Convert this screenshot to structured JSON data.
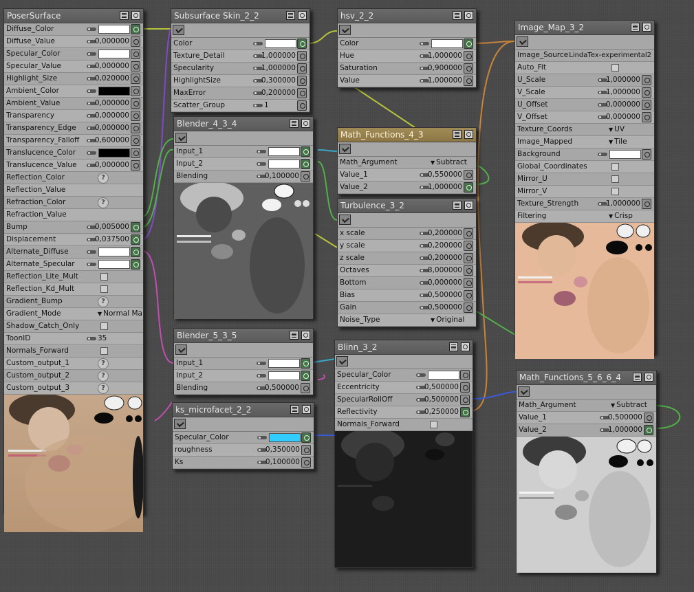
{
  "nodes": {
    "poser_surface": {
      "title": "PoserSurface",
      "rows": [
        {
          "label": "Diffuse_Color",
          "kind": "color",
          "color": "#ffffff",
          "plug": "connected"
        },
        {
          "label": "Diffuse_Value",
          "kind": "number",
          "value": "0,000000",
          "plug": "plain"
        },
        {
          "label": "Specular_Color",
          "kind": "color",
          "color": "#ffffff",
          "plug": "plain"
        },
        {
          "label": "Specular_Value",
          "kind": "number",
          "value": "0,000000",
          "plug": "plain"
        },
        {
          "label": "Highlight_Size",
          "kind": "number",
          "value": "0,020000",
          "plug": "plain"
        },
        {
          "label": "Ambient_Color",
          "kind": "color",
          "color": "#000000",
          "plug": "plain"
        },
        {
          "label": "Ambient_Value",
          "kind": "number",
          "value": "0,000000",
          "plug": "plain"
        },
        {
          "label": "Transparency",
          "kind": "number",
          "value": "0,000000",
          "plug": "plain"
        },
        {
          "label": "Transparency_Edge",
          "kind": "number",
          "value": "0,000000",
          "plug": "plain"
        },
        {
          "label": "Transparency_Falloff",
          "kind": "number",
          "value": "0,600000",
          "plug": "plain"
        },
        {
          "label": "Translucence_Color",
          "kind": "color",
          "color": "#000000",
          "plug": "plain"
        },
        {
          "label": "Translucence_Value",
          "kind": "number",
          "value": "0,000000",
          "plug": "plain"
        },
        {
          "label": "Reflection_Color",
          "kind": "help"
        },
        {
          "label": "Reflection_Value",
          "kind": "empty"
        },
        {
          "label": "Refraction_Color",
          "kind": "help"
        },
        {
          "label": "Refraction_Value",
          "kind": "empty"
        },
        {
          "label": "Bump",
          "kind": "number",
          "value": "0,005000",
          "plug": "connected"
        },
        {
          "label": "Displacement",
          "kind": "number",
          "value": "0,037500",
          "plug": "connected"
        },
        {
          "label": "Alternate_Diffuse",
          "kind": "color",
          "color": "#ffffff",
          "plug": "connected"
        },
        {
          "label": "Alternate_Specular",
          "kind": "color",
          "color": "#ffffff",
          "plug": "connected"
        },
        {
          "label": "Reflection_Lite_Mult",
          "kind": "check"
        },
        {
          "label": "Reflection_Kd_Mult",
          "kind": "check"
        },
        {
          "label": "Gradient_Bump",
          "kind": "help"
        },
        {
          "label": "Gradient_Mode",
          "kind": "dropdown",
          "value": "Normal Ma"
        },
        {
          "label": "Shadow_Catch_Only",
          "kind": "check"
        },
        {
          "label": "ToonID",
          "kind": "number",
          "value": "35",
          "align": "left"
        },
        {
          "label": "Normals_Forward",
          "kind": "check"
        },
        {
          "label": "Custom_output_1",
          "kind": "help"
        },
        {
          "label": "Custom_output_2",
          "kind": "help"
        },
        {
          "label": "Custom_output_3",
          "kind": "help"
        }
      ]
    },
    "subsurface_skin": {
      "title": "Subsurface Skin_2_2",
      "rows": [
        {
          "label": "Color",
          "kind": "color",
          "color": "#ffffff",
          "plug": "connected"
        },
        {
          "label": "Texture_Detail",
          "kind": "number",
          "value": "1,000000",
          "plug": "plain"
        },
        {
          "label": "Specularity",
          "kind": "number",
          "value": "1,000000",
          "plug": "plain"
        },
        {
          "label": "HighlightSize",
          "kind": "number",
          "value": "0,300000",
          "plug": "plain"
        },
        {
          "label": "MaxError",
          "kind": "number",
          "value": "0,200000",
          "plug": "plain"
        },
        {
          "label": "Scatter_Group",
          "kind": "number",
          "value": "1",
          "align": "left",
          "plug": "plain"
        }
      ]
    },
    "hsv": {
      "title": "hsv_2_2",
      "rows": [
        {
          "label": "Color",
          "kind": "color",
          "color": "#ffffff",
          "plug": "connected"
        },
        {
          "label": "Hue",
          "kind": "number",
          "value": "1,000000",
          "plug": "plain"
        },
        {
          "label": "Saturation",
          "kind": "number",
          "value": "0,900000",
          "plug": "plain"
        },
        {
          "label": "Value",
          "kind": "number",
          "value": "1,000000",
          "plug": "plain"
        }
      ]
    },
    "image_map": {
      "title": "Image_Map_3_2",
      "rows": [
        {
          "label": "Image_Source",
          "kind": "text",
          "value": "LindaTex-experimental2"
        },
        {
          "label": "Auto_Fit",
          "kind": "check"
        },
        {
          "label": "U_Scale",
          "kind": "number",
          "value": "1,000000",
          "plug": "plain"
        },
        {
          "label": "V_Scale",
          "kind": "number",
          "value": "1,000000",
          "plug": "plain"
        },
        {
          "label": "U_Offset",
          "kind": "number",
          "value": "0,000000",
          "plug": "plain"
        },
        {
          "label": "V_Offset",
          "kind": "number",
          "value": "0,000000",
          "plug": "plain"
        },
        {
          "label": "Texture_Coords",
          "kind": "dropdown",
          "value": "UV"
        },
        {
          "label": "Image_Mapped",
          "kind": "dropdown",
          "value": "Tile"
        },
        {
          "label": "Background",
          "kind": "color",
          "color": "#ffffff",
          "plug": "plain"
        },
        {
          "label": "Global_Coordinates",
          "kind": "check"
        },
        {
          "label": "Mirror_U",
          "kind": "check"
        },
        {
          "label": "Mirror_V",
          "kind": "check"
        },
        {
          "label": "Texture_Strength",
          "kind": "number",
          "value": "1,000000",
          "plug": "plain"
        },
        {
          "label": "Filtering",
          "kind": "dropdown",
          "value": "Crisp"
        }
      ]
    },
    "blender_4": {
      "title": "Blender_4_3_4",
      "rows": [
        {
          "label": "Input_1",
          "kind": "color",
          "color": "#ffffff",
          "plug": "connected"
        },
        {
          "label": "Input_2",
          "kind": "color",
          "color": "#ffffff",
          "plug": "connected"
        },
        {
          "label": "Blending",
          "kind": "number",
          "value": "0,100000",
          "plug": "plain"
        }
      ]
    },
    "math_4": {
      "title": "Math_Functions_4_3",
      "rows": [
        {
          "label": "Math_Argument",
          "kind": "dropdown",
          "value": "Subtract"
        },
        {
          "label": "Value_1",
          "kind": "number",
          "value": "0,550000",
          "plug": "plain"
        },
        {
          "label": "Value_2",
          "kind": "number",
          "value": "1,000000",
          "plug": "connected"
        }
      ]
    },
    "turbulence": {
      "title": "Turbulence_3_2",
      "rows": [
        {
          "label": "x scale",
          "kind": "number",
          "value": "0,200000",
          "plug": "plain"
        },
        {
          "label": "y scale",
          "kind": "number",
          "value": "0,200000",
          "plug": "plain"
        },
        {
          "label": "z scale",
          "kind": "number",
          "value": "0,200000",
          "plug": "plain"
        },
        {
          "label": "Octaves",
          "kind": "number",
          "value": "8,000000",
          "plug": "plain"
        },
        {
          "label": "Bottom",
          "kind": "number",
          "value": "0,000000",
          "plug": "plain"
        },
        {
          "label": "Bias",
          "kind": "number",
          "value": "0,500000",
          "plug": "plain"
        },
        {
          "label": "Gain",
          "kind": "number",
          "value": "0,500000",
          "plug": "plain"
        },
        {
          "label": "Noise_Type",
          "kind": "dropdown",
          "value": "Original"
        }
      ]
    },
    "blender_5": {
      "title": "Blender_5_3_5",
      "rows": [
        {
          "label": "Input_1",
          "kind": "color",
          "color": "#ffffff",
          "plug": "connected"
        },
        {
          "label": "Input_2",
          "kind": "color",
          "color": "#ffffff",
          "plug": "connected"
        },
        {
          "label": "Blending",
          "kind": "number",
          "value": "0,500000",
          "plug": "plain"
        }
      ]
    },
    "blinn": {
      "title": "Blinn_3_2",
      "rows": [
        {
          "label": "Specular_Color",
          "kind": "color",
          "color": "#ffffff",
          "plug": "plain"
        },
        {
          "label": "Eccentricity",
          "kind": "number",
          "value": "0,500000",
          "plug": "plain"
        },
        {
          "label": "SpecularRollOff",
          "kind": "number",
          "value": "0,500000",
          "plug": "plain"
        },
        {
          "label": "Reflectivity",
          "kind": "number",
          "value": "0,250000",
          "plug": "connected"
        },
        {
          "label": "Normals_Forward",
          "kind": "check"
        }
      ]
    },
    "ks_microfacet": {
      "title": "ks_microfacet_2_2",
      "rows": [
        {
          "label": "Specular_Color",
          "kind": "color",
          "color": "#33ccff",
          "plug": "connected"
        },
        {
          "label": "roughness",
          "kind": "number",
          "value": "0,350000",
          "plug": "plain"
        },
        {
          "label": "Ks",
          "kind": "number",
          "value": "0,100000",
          "plug": "plain"
        }
      ]
    },
    "math_5": {
      "title": "Math_Functions_5_6_6_4",
      "rows": [
        {
          "label": "Math_Argument",
          "kind": "dropdown",
          "value": "Subtract"
        },
        {
          "label": "Value_1",
          "kind": "number",
          "value": "0,500000",
          "plug": "plain"
        },
        {
          "label": "Value_2",
          "kind": "number",
          "value": "1,000000",
          "plug": "connected"
        }
      ]
    }
  },
  "colors": {
    "wire_yellow": "#b7c43a",
    "wire_green": "#52b04a",
    "wire_orange": "#c8843a",
    "wire_purple": "#8448c8",
    "wire_magenta": "#c050b0",
    "wire_blue": "#3a5ad8",
    "wire_cyan": "#3aa8c8"
  }
}
